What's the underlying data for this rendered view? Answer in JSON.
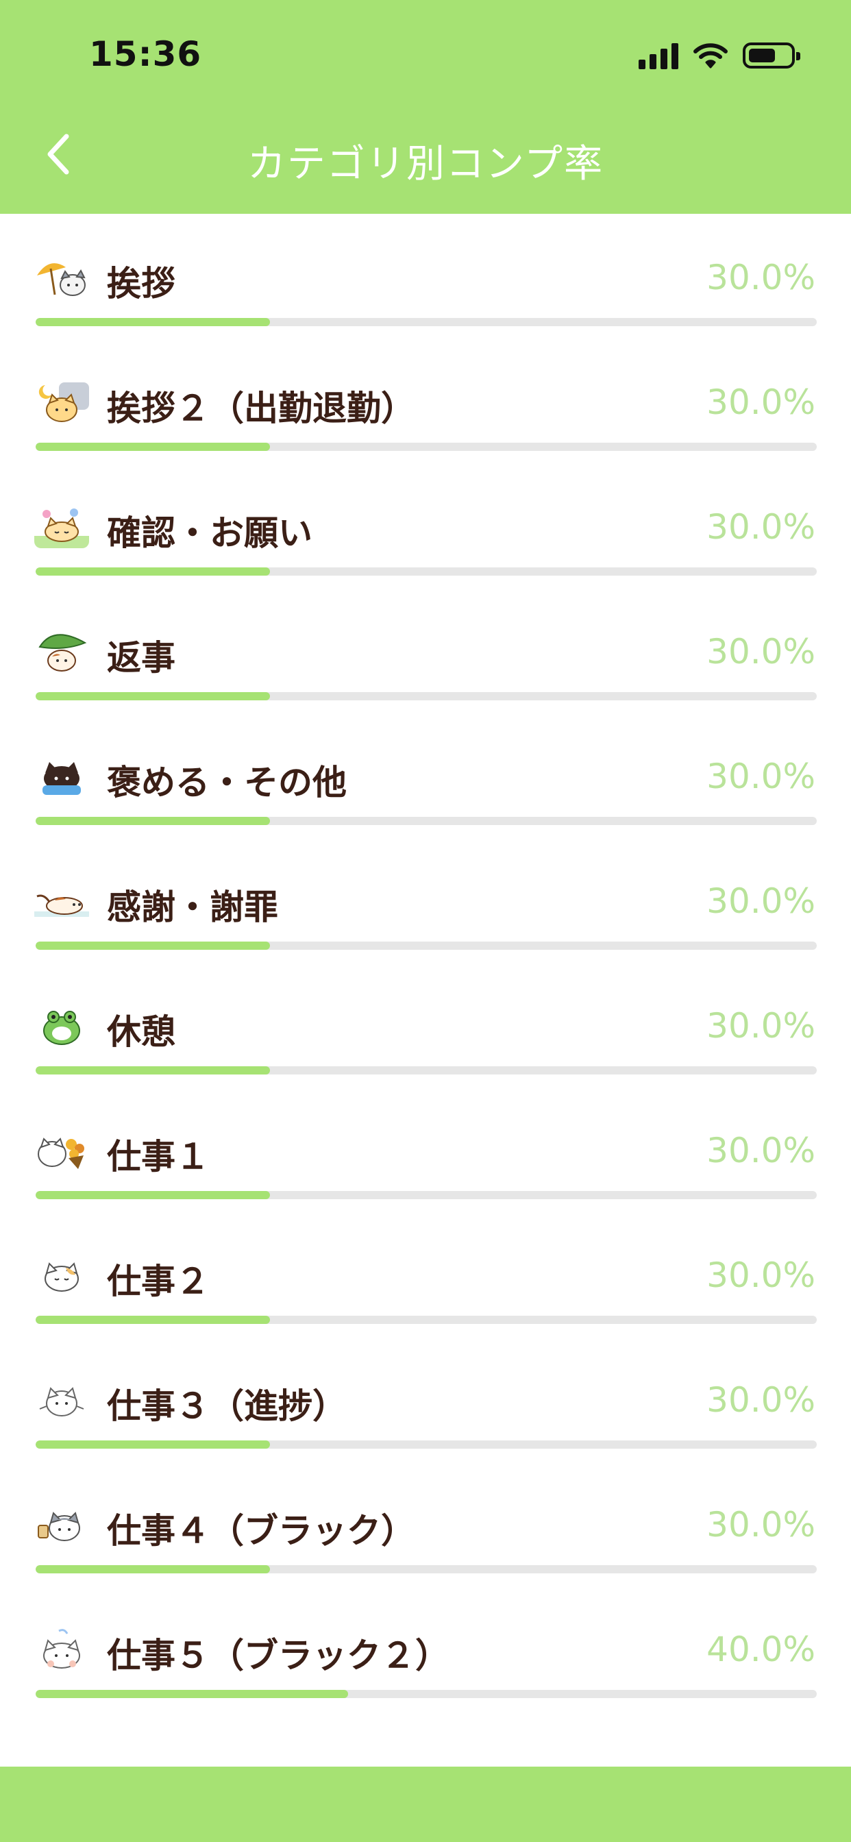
{
  "status_bar": {
    "time": "15:36"
  },
  "header": {
    "title": "カテゴリ別コンプ率"
  },
  "categories": [
    {
      "label": "挨拶",
      "percent_text": "30.0%",
      "progress": 0.3,
      "icon": "cat-umbrella-icon"
    },
    {
      "label": "挨拶２（出勤退勤）",
      "percent_text": "30.0%",
      "progress": 0.3,
      "icon": "cat-moon-icon"
    },
    {
      "label": "確認・お願い",
      "percent_text": "30.0%",
      "progress": 0.3,
      "icon": "cat-flowers-icon"
    },
    {
      "label": "返事",
      "percent_text": "30.0%",
      "progress": 0.3,
      "icon": "cat-leaf-icon"
    },
    {
      "label": "褒める・その他",
      "percent_text": "30.0%",
      "progress": 0.3,
      "icon": "black-cat-icon"
    },
    {
      "label": "感謝・謝罪",
      "percent_text": "30.0%",
      "progress": 0.3,
      "icon": "cat-lying-icon"
    },
    {
      "label": "休憩",
      "percent_text": "30.0%",
      "progress": 0.3,
      "icon": "frog-cat-icon"
    },
    {
      "label": "仕事１",
      "percent_text": "30.0%",
      "progress": 0.3,
      "icon": "cat-bouquet-icon"
    },
    {
      "label": "仕事２",
      "percent_text": "30.0%",
      "progress": 0.3,
      "icon": "cat-face-icon"
    },
    {
      "label": "仕事３（進捗）",
      "percent_text": "30.0%",
      "progress": 0.3,
      "icon": "cat-sketch-icon"
    },
    {
      "label": "仕事４（ブラック）",
      "percent_text": "30.0%",
      "progress": 0.3,
      "icon": "cat-grey-icon"
    },
    {
      "label": "仕事５（ブラック２）",
      "percent_text": "40.0%",
      "progress": 0.4,
      "icon": "cat-peek-icon"
    }
  ],
  "colors": {
    "accent": "#a6e273",
    "percent_text": "#b9e39a",
    "label_text": "#3b1f16",
    "track": "#e6e6e6"
  }
}
